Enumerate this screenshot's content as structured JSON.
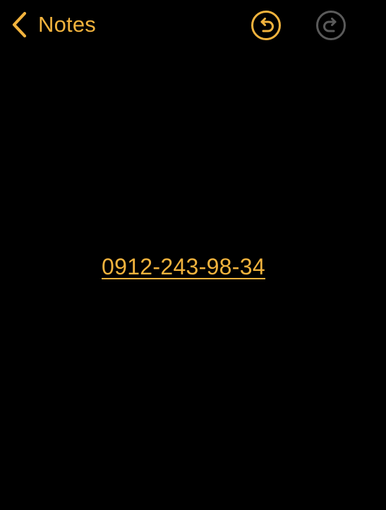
{
  "nav": {
    "back_label": "Notes"
  },
  "note": {
    "phone_number": "0912-243-98-34"
  },
  "icons": {
    "back": "chevron-left-icon",
    "undo": "undo-icon",
    "redo": "redo-icon"
  },
  "colors": {
    "accent": "#F2B33D",
    "disabled": "#5A5A5A",
    "background": "#000000"
  }
}
